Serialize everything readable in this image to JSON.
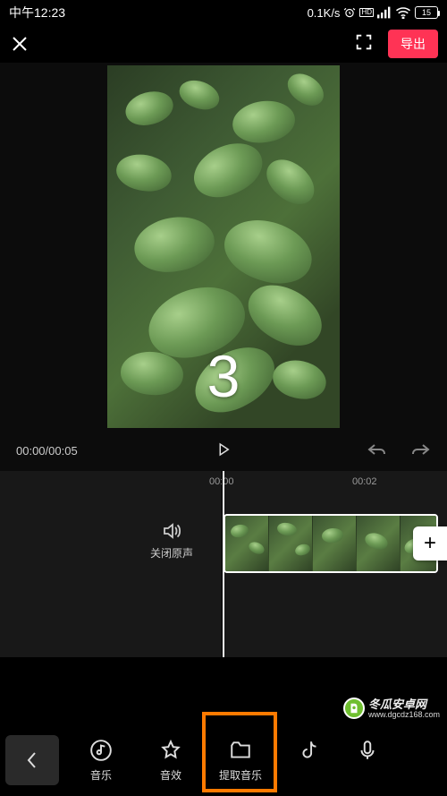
{
  "status": {
    "time": "中午12:23",
    "net_speed": "0.1K/s",
    "battery_pct": "15"
  },
  "topbar": {
    "export_label": "导出"
  },
  "preview": {
    "overlay_number": "3"
  },
  "playback": {
    "time_display": "00:00/00:05"
  },
  "timeline": {
    "ticks": [
      "00:00",
      "00:02"
    ],
    "original_sound_label": "关闭原声"
  },
  "toolbar": {
    "items": [
      {
        "id": "music",
        "label": "音乐",
        "icon": "music-note-icon"
      },
      {
        "id": "sfx",
        "label": "音效",
        "icon": "star-icon"
      },
      {
        "id": "extract",
        "label": "提取音乐",
        "icon": "folder-icon"
      },
      {
        "id": "douyin",
        "label": "",
        "icon": "douyin-icon"
      },
      {
        "id": "record",
        "label": "",
        "icon": "mic-icon"
      }
    ]
  },
  "watermark": {
    "text": "冬瓜安卓网",
    "url": "www.dgcdz168.com"
  }
}
